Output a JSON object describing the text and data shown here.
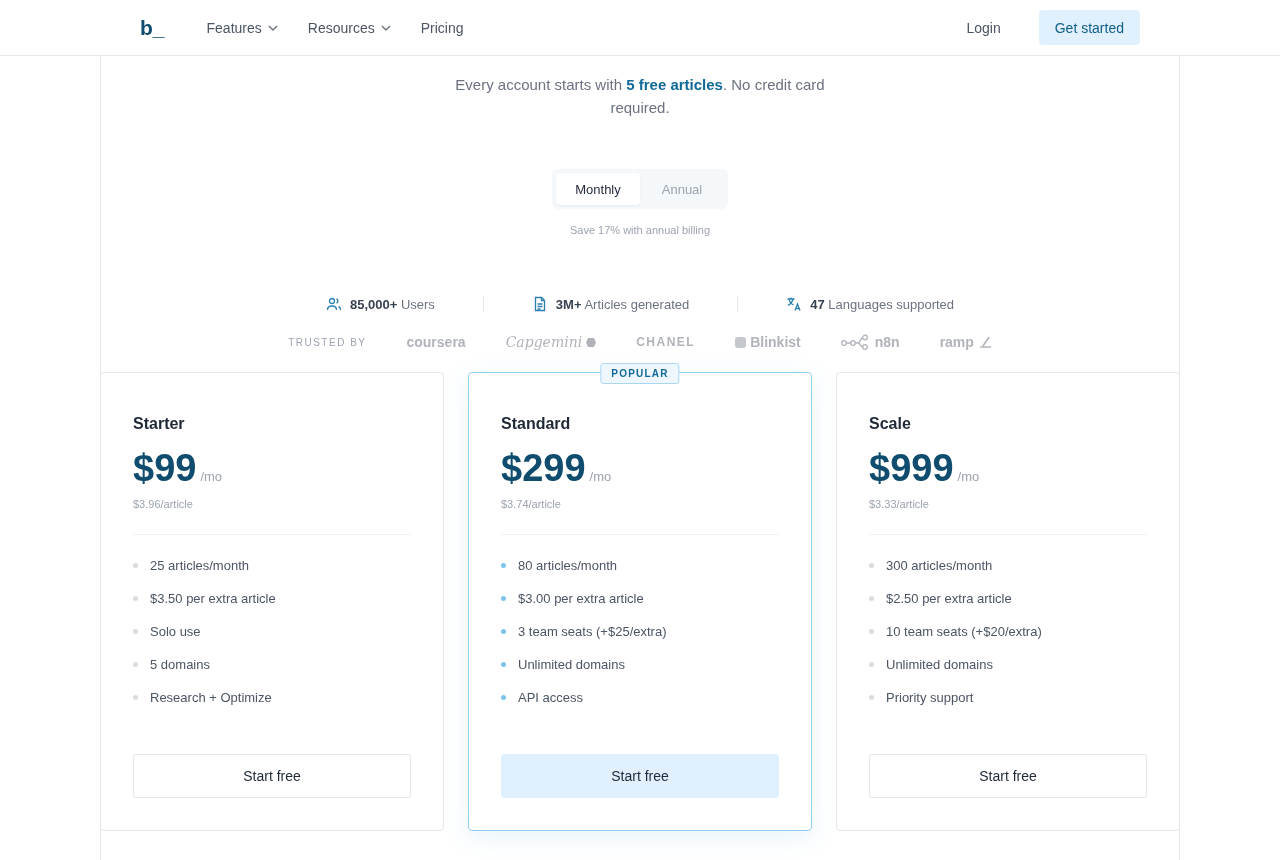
{
  "nav": {
    "logo": "b_",
    "links": [
      {
        "label": "Features",
        "dropdown": true
      },
      {
        "label": "Resources",
        "dropdown": true
      },
      {
        "label": "Pricing",
        "dropdown": false
      }
    ],
    "login": "Login",
    "cta": "Get started"
  },
  "intro": "Every account starts with **5 free articles**. No credit card required.",
  "billing": {
    "options": [
      {
        "label": "Monthly",
        "selected": true
      },
      {
        "label": "Annual",
        "selected": false
      }
    ],
    "note": "Save 17% with annual billing"
  },
  "stats": [
    {
      "kind": "users",
      "value": "85,000+",
      "label": "Users"
    },
    {
      "kind": "articles",
      "value": "3M+",
      "label": "Articles generated"
    },
    {
      "kind": "languages",
      "value": "47",
      "label": "Languages supported"
    }
  ],
  "trusted": {
    "label": "TRUSTED BY",
    "logos": [
      {
        "kind": "plain",
        "name": "coursera"
      },
      {
        "kind": "script",
        "name": "Capgemini"
      },
      {
        "kind": "caps",
        "name": "CHANEL"
      },
      {
        "kind": "badge",
        "name": "Blinkist"
      },
      {
        "kind": "nodes",
        "name": "n8n"
      },
      {
        "kind": "swoosh",
        "name": "ramp"
      }
    ]
  },
  "plans": [
    {
      "name": "Starter",
      "price": "$99",
      "period": "/mo",
      "per_article": "$3.96/article",
      "popular": false,
      "features": [
        "25 articles/month",
        "$3.50 per extra article",
        "Solo use",
        "5 domains",
        "Research + Optimize"
      ],
      "button": "Start free"
    },
    {
      "name": "Standard",
      "price": "$299",
      "period": "/mo",
      "per_article": "$3.74/article",
      "popular": true,
      "badge": "POPULAR",
      "features": [
        "80 articles/month",
        "$3.00 per extra article",
        "3 team seats (+$25/extra)",
        "Unlimited domains",
        "API access"
      ],
      "button": "Start free"
    },
    {
      "name": "Scale",
      "price": "$999",
      "period": "/mo",
      "per_article": "$3.33/article",
      "popular": false,
      "features": [
        "300 articles/month",
        "$2.50 per extra article",
        "10 team seats (+$20/extra)",
        "Unlimited domains",
        "Priority support"
      ],
      "button": "Start free"
    }
  ]
}
